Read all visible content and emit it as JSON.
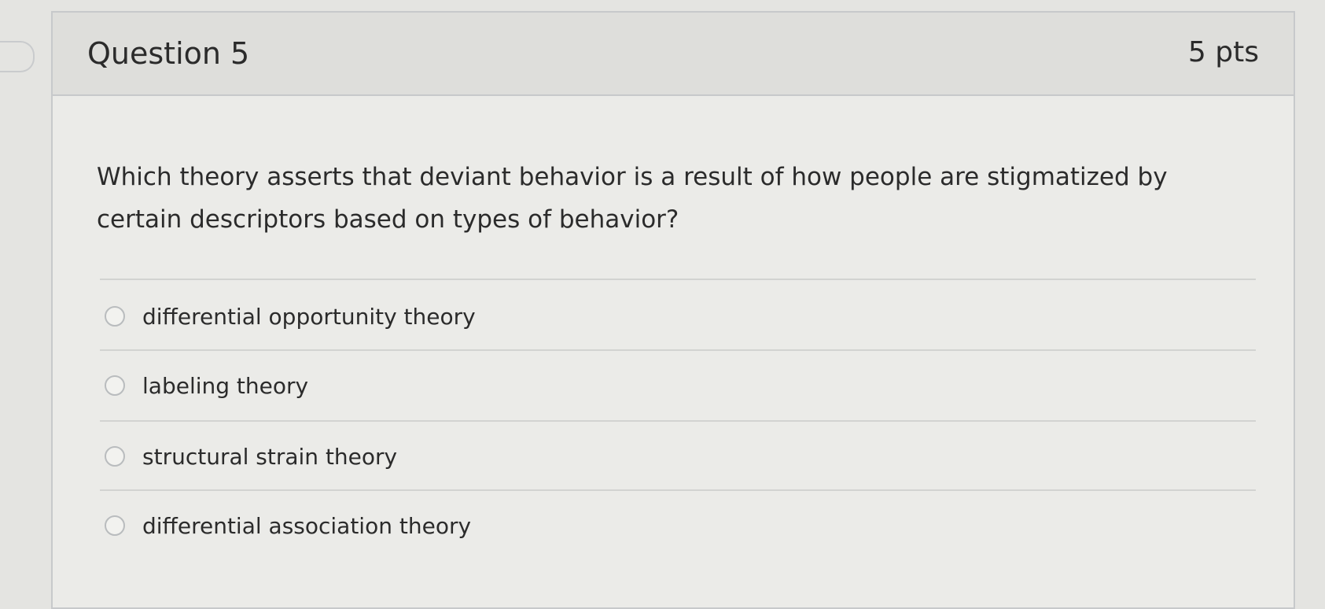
{
  "question": {
    "title": "Question 5",
    "points": "5 pts",
    "text": "Which theory asserts that deviant behavior is a result of how people are stigmatized by certain descriptors based on types of behavior?"
  },
  "answers": [
    {
      "label": "differential opportunity theory",
      "selected": false
    },
    {
      "label": "labeling theory",
      "selected": false
    },
    {
      "label": "structural strain theory",
      "selected": false
    },
    {
      "label": "differential association theory",
      "selected": false
    }
  ]
}
